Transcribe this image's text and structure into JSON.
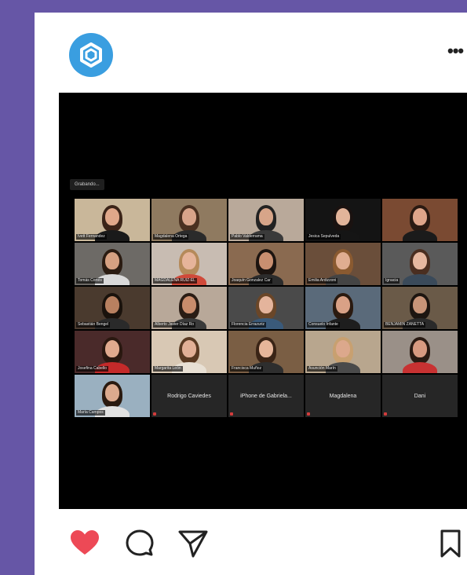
{
  "profile": {
    "avatar_icon": "brand-logo-icon"
  },
  "post": {
    "meeting_badge": "Grabando...",
    "tiles": [
      {
        "name": "Ivett Fernandez",
        "skin": "#e0a88a",
        "hair": "#3b2418",
        "shirt": "#1a1a1a",
        "bg": "#c9b79a",
        "active": true
      },
      {
        "name": "Magdalena Ortega",
        "skin": "#d8a48a",
        "hair": "#4a3020",
        "shirt": "#2b2b2b",
        "bg": "#8f7a60"
      },
      {
        "name": "Pablo Valderrama",
        "skin": "#d7a589",
        "hair": "#222",
        "shirt": "#3a3a3a",
        "bg": "#b9a99a"
      },
      {
        "name": "Jesica Sepulveda",
        "skin": "#e2b49a",
        "hair": "#1a1210",
        "shirt": "#151515",
        "bg": "#141414"
      },
      {
        "name": "",
        "skin": "#dea58a",
        "hair": "#2a1a12",
        "shirt": "#1b1b1b",
        "bg": "#7a4a32"
      },
      {
        "name": "Tomás Cortés",
        "skin": "#d6a182",
        "hair": "#2b1c12",
        "shirt": "#d9d9d9",
        "bg": "#6d6a66"
      },
      {
        "name": "MAGDALENA RUIZ-EL",
        "skin": "#e6b49a",
        "hair": "#b58a5a",
        "shirt": "#d04a3a",
        "bg": "#c8bcb2"
      },
      {
        "name": "Joaquín Gonzalez Car",
        "skin": "#c98f70",
        "hair": "#1c1410",
        "shirt": "#2c2c2c",
        "bg": "#8a6a50"
      },
      {
        "name": "Emilia Ardizzoni",
        "skin": "#e0ad90",
        "hair": "#8a5a30",
        "shirt": "#444",
        "bg": "#6a4e3a"
      },
      {
        "name": "Ignacia",
        "skin": "#e6b8a0",
        "hair": "#4a2e20",
        "shirt": "#3a4a5a",
        "bg": "#5a5a5a"
      },
      {
        "name": "Sebastián Bengel",
        "skin": "#b88060",
        "hair": "#1a120c",
        "shirt": "#2a2a2a",
        "bg": "#4a3a2e"
      },
      {
        "name": "Alberto Javier Díaz Ro",
        "skin": "#c98c6c",
        "hair": "#2a1c14",
        "shirt": "#3a3a3a",
        "bg": "#b8a899"
      },
      {
        "name": "Florencia Errazuriz",
        "skin": "#e4b49c",
        "hair": "#6a4628",
        "shirt": "#3a5a7a",
        "bg": "#4a4a4a"
      },
      {
        "name": "Consuelo Infante",
        "skin": "#d9a186",
        "hair": "#2a1a10",
        "shirt": "#1e1e1e",
        "bg": "#5a6a7a"
      },
      {
        "name": "BENJAMÍN ZANETTA",
        "skin": "#c89478",
        "hair": "#1d1510",
        "shirt": "#2a2a2a",
        "bg": "#6a5a48"
      },
      {
        "name": "Josefina Cabello",
        "skin": "#e0aa8e",
        "hair": "#2a1810",
        "shirt": "#c42a2a",
        "bg": "#4a2a2a"
      },
      {
        "name": "Margarita León",
        "skin": "#e2b096",
        "hair": "#5a3a22",
        "shirt": "#e8e0d4",
        "bg": "#d8c8b4"
      },
      {
        "name": "Francisca Muñoz",
        "skin": "#e6b69a",
        "hair": "#3a2416",
        "shirt": "#2e2e2e",
        "bg": "#7a5e44"
      },
      {
        "name": "Asunción Marín",
        "skin": "#dca88c",
        "hair": "#c8a070",
        "shirt": "#4a4a4a",
        "bg": "#b8a68e"
      },
      {
        "name": "",
        "skin": "#d89a80",
        "hair": "#2a1a12",
        "shirt": "#c83232",
        "bg": "#9a9088"
      },
      {
        "name": "María Campos",
        "skin": "#dcaa8e",
        "hair": "#2a1a10",
        "shirt": "#e2e2e2",
        "bg": "#9ab0c0"
      },
      {
        "name": "Rodrigo Caviedes",
        "text_only": true
      },
      {
        "name": "iPhone de Gabriela...",
        "text_only": true
      },
      {
        "name": "Magdalena",
        "text_only": true
      },
      {
        "name": "Dani",
        "text_only": true
      }
    ]
  },
  "actions": {
    "like_icon": "heart-icon",
    "comment_icon": "comment-icon",
    "share_icon": "share-icon",
    "save_icon": "bookmark-icon",
    "like_color": "#ed4956"
  }
}
